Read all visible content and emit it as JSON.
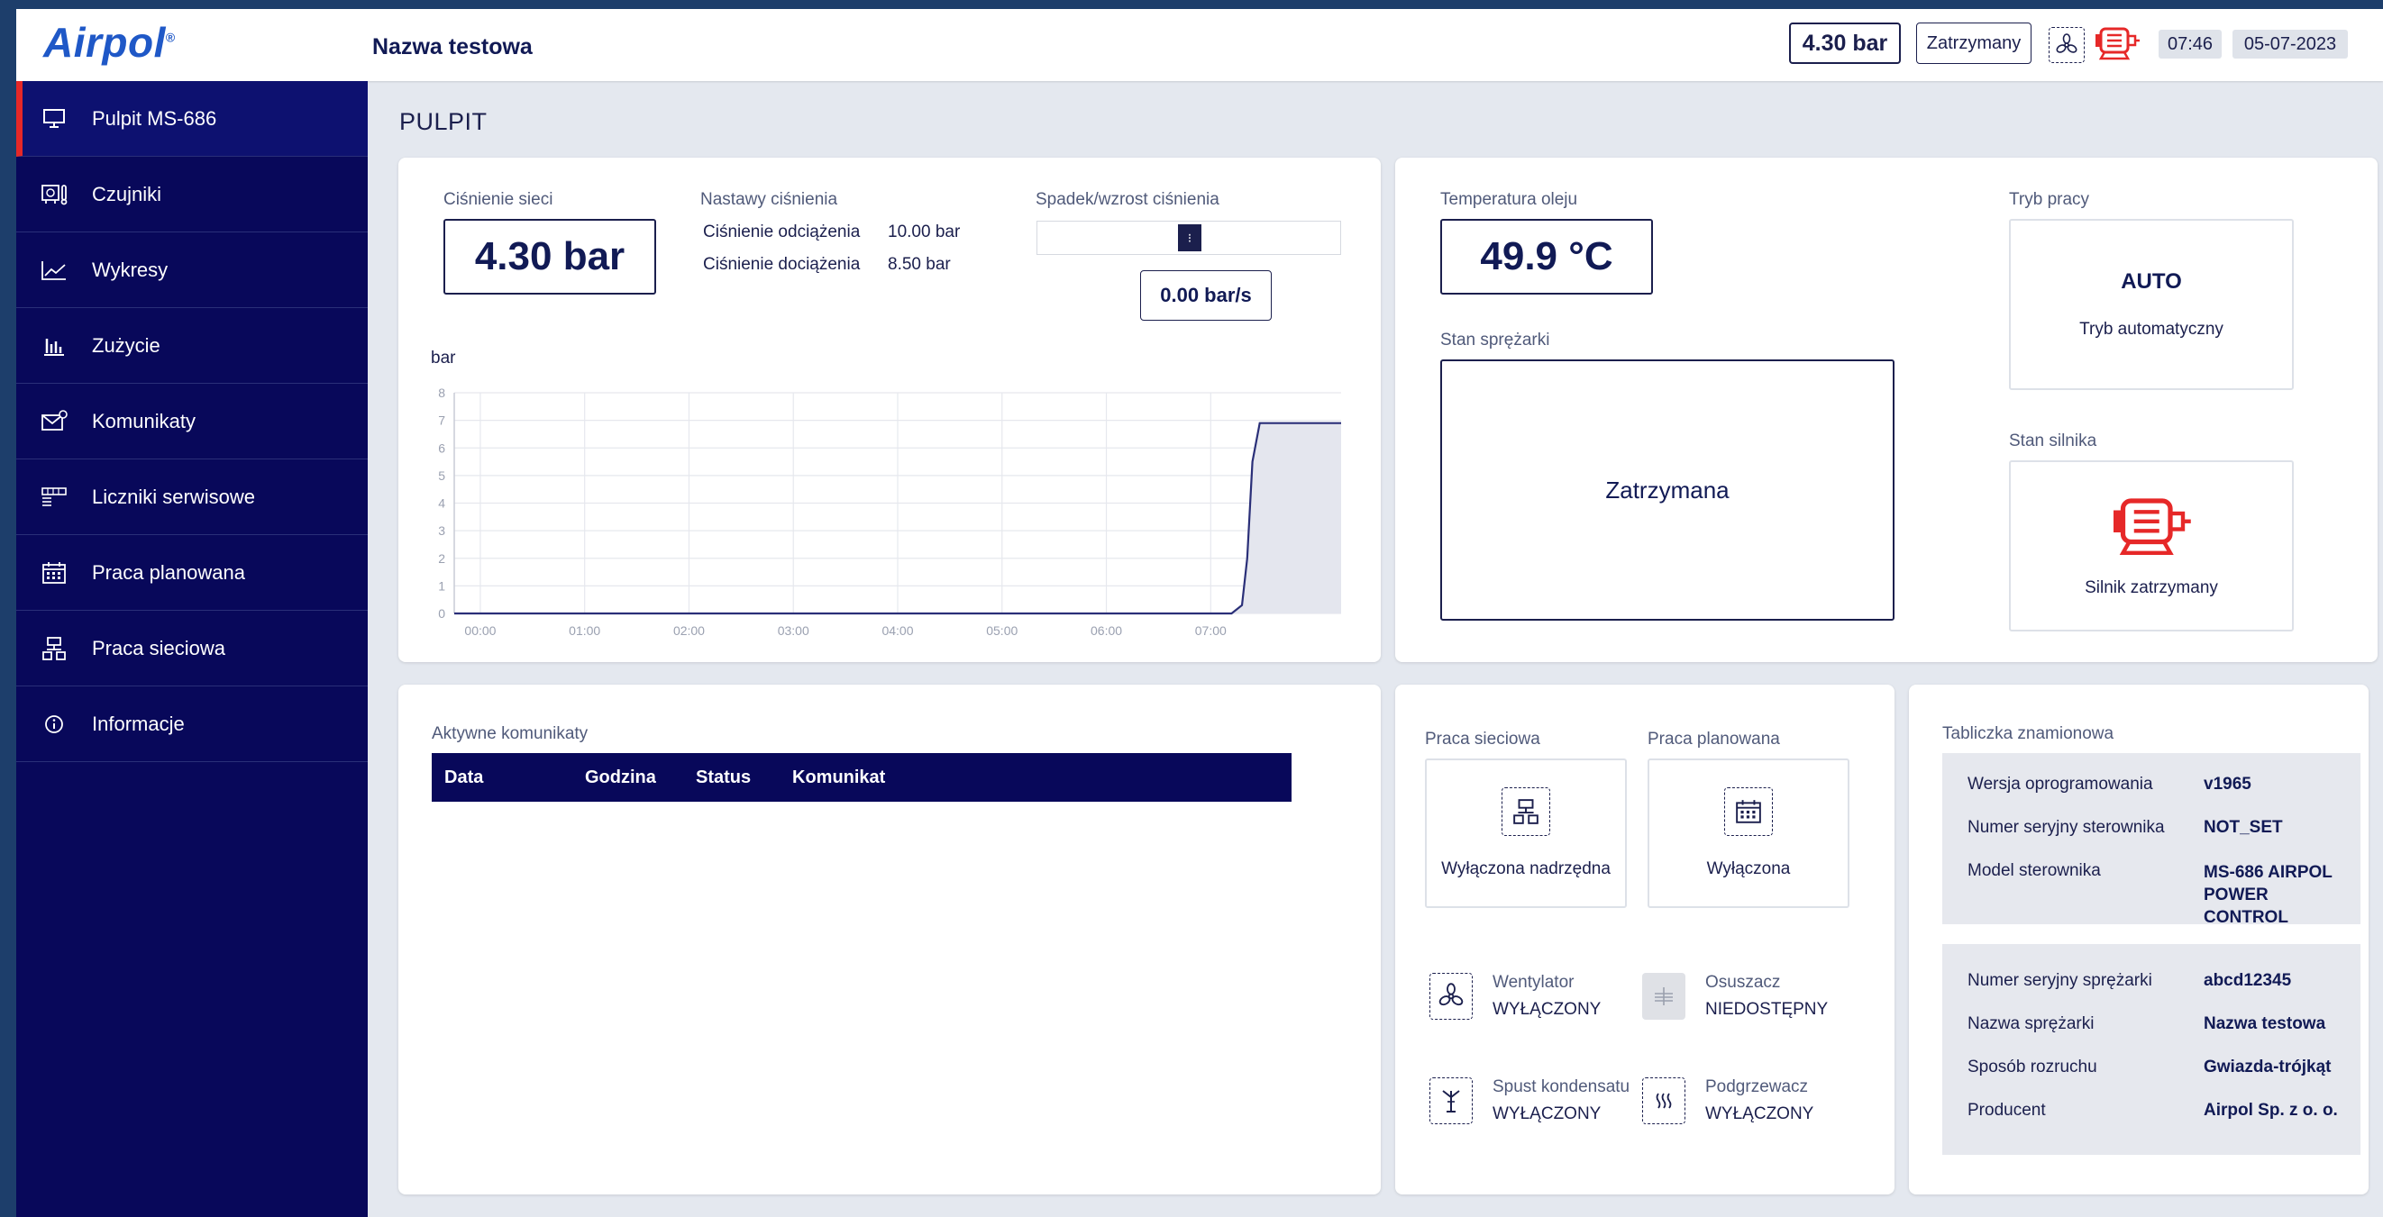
{
  "header": {
    "logo": "Airpol",
    "logo_mark": "®",
    "device_name": "Nazwa testowa",
    "pressure": "4.30 bar",
    "state": "Zatrzymany",
    "fan_icon": "fan-icon",
    "motor_icon": "motor-icon",
    "time": "07:46",
    "date": "05-07-2023"
  },
  "sidebar": {
    "items": [
      {
        "label": "Pulpit MS-686",
        "icon": "monitor-icon"
      },
      {
        "label": "Czujniki",
        "icon": "sensor-icon"
      },
      {
        "label": "Wykresy",
        "icon": "line-chart-icon"
      },
      {
        "label": "Zużycie",
        "icon": "bar-chart-icon"
      },
      {
        "label": "Komunikaty",
        "icon": "envelope-icon"
      },
      {
        "label": "Liczniki serwisowe",
        "icon": "counter-icon"
      },
      {
        "label": "Praca planowana",
        "icon": "calendar-icon"
      },
      {
        "label": "Praca sieciowa",
        "icon": "network-icon"
      },
      {
        "label": "Informacje",
        "icon": "info-icon"
      }
    ]
  },
  "page_title": "PULPIT",
  "pressure_card": {
    "net_label": "Ciśnienie sieci",
    "net_value": "4.30 bar",
    "settings_label": "Nastawy ciśnienia",
    "unload_label": "Ciśnienie odciążenia",
    "unload_value": "10.00 bar",
    "load_label": "Ciśnienie dociążenia",
    "load_value": "8.50 bar",
    "rate_label": "Spadek/wzrost ciśnienia",
    "rate_value": "0.00 bar/s"
  },
  "chart_data": {
    "type": "area",
    "ylabel": "bar",
    "ylim": [
      0,
      8
    ],
    "yticks": [
      "0",
      "1",
      "2",
      "3",
      "4",
      "5",
      "6",
      "7",
      "8"
    ],
    "xticks": [
      "00:00",
      "01:00",
      "02:00",
      "03:00",
      "04:00",
      "05:00",
      "06:00",
      "07:00"
    ],
    "xlim": [
      0,
      8.5
    ],
    "x": [
      0,
      7.45,
      7.55,
      7.6,
      7.65,
      7.72,
      8.5
    ],
    "y": [
      0,
      0,
      0.3,
      2.0,
      5.5,
      6.9,
      6.9
    ],
    "grid": true,
    "color": "#2a2f78"
  },
  "status_card": {
    "oil_label": "Temperatura oleju",
    "oil_value": "49.9 °C",
    "comp_state_label": "Stan sprężarki",
    "comp_state_value": "Zatrzymana",
    "mode_label": "Tryb pracy",
    "mode_value": "AUTO",
    "mode_desc": "Tryb automatyczny",
    "motor_label": "Stan silnika",
    "motor_value": "Silnik zatrzymany",
    "motor_color": "#e62828"
  },
  "messages": {
    "title": "Aktywne komunikaty",
    "columns": [
      "Data",
      "Godzina",
      "Status",
      "Komunikat"
    ]
  },
  "work": {
    "network_label": "Praca sieciowa",
    "network_value": "Wyłączona nadrzędna",
    "planned_label": "Praca planowana",
    "planned_value": "Wyłączona",
    "devices": [
      {
        "name": "Wentylator",
        "state": "WYŁĄCZONY",
        "icon": "fan-icon"
      },
      {
        "name": "Osuszacz",
        "state": "NIEDOSTĘPNY",
        "icon": "dryer-icon"
      },
      {
        "name": "Spust kondensatu",
        "state": "WYŁĄCZONY",
        "icon": "drain-icon"
      },
      {
        "name": "Podgrzewacz",
        "state": "WYŁĄCZONY",
        "icon": "heater-icon"
      }
    ]
  },
  "nameplate": {
    "title": "Tabliczka znamionowa",
    "controller": [
      {
        "key": "Wersja oprogramowania",
        "value": "v1965"
      },
      {
        "key": "Numer seryjny sterownika",
        "value": "NOT_SET"
      },
      {
        "key": "Model sterownika",
        "value": "MS-686 AIRPOL POWER CONTROL"
      }
    ],
    "compressor": [
      {
        "key": "Numer seryjny sprężarki",
        "value": "abcd12345"
      },
      {
        "key": "Nazwa sprężarki",
        "value": "Nazwa testowa"
      },
      {
        "key": "Sposób rozruchu",
        "value": "Gwiazda-trójkąt"
      },
      {
        "key": "Producent",
        "value": "Airpol Sp. z o. o."
      }
    ]
  }
}
